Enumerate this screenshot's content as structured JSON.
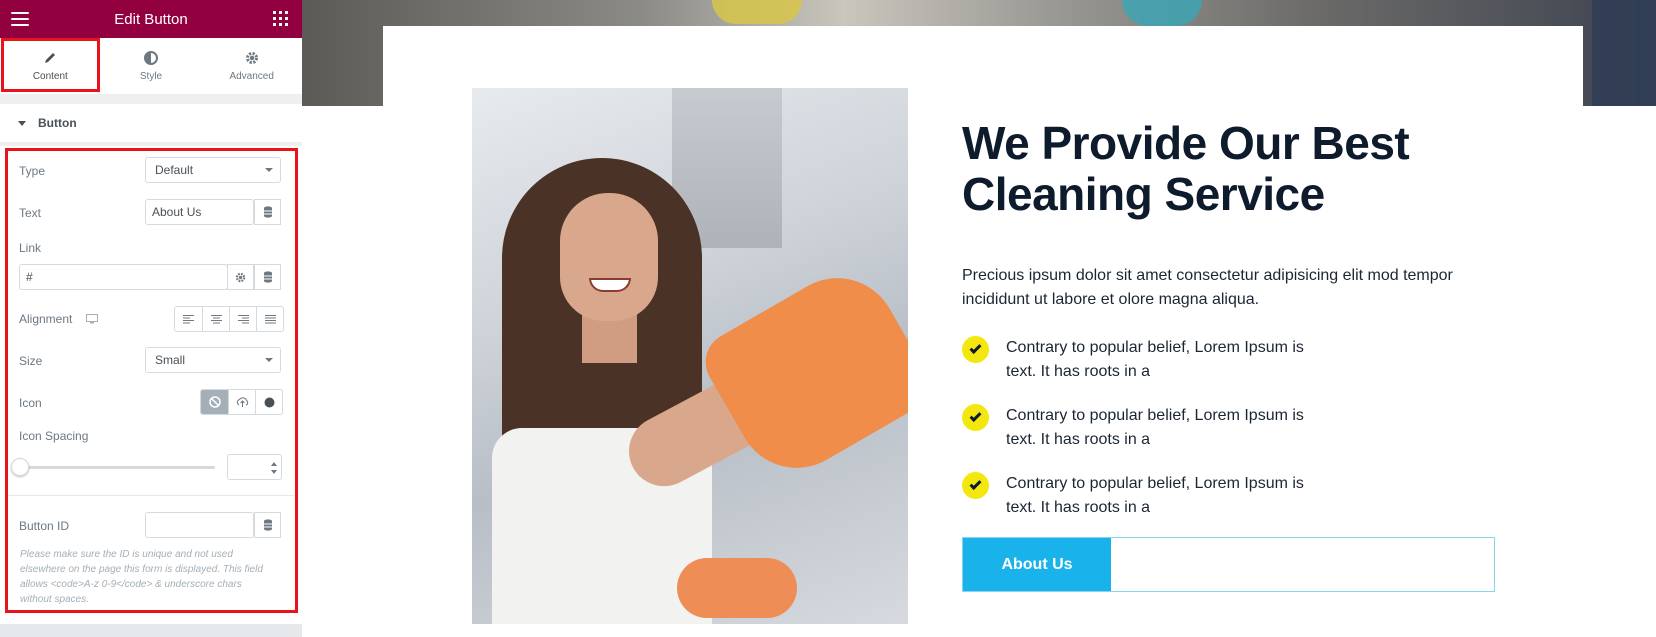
{
  "panel": {
    "title": "Edit Button",
    "tabs": [
      {
        "label": "Content",
        "icon": "pencil-icon",
        "active": true
      },
      {
        "label": "Style",
        "icon": "half-circle-icon",
        "active": false
      },
      {
        "label": "Advanced",
        "icon": "gear-icon",
        "active": false
      }
    ],
    "section_title": "Button",
    "controls": {
      "type_label": "Type",
      "type_value": "Default",
      "text_label": "Text",
      "text_value": "About Us",
      "link_label": "Link",
      "link_value": "#",
      "alignment_label": "Alignment",
      "size_label": "Size",
      "size_value": "Small",
      "icon_label": "Icon",
      "icon_spacing_label": "Icon Spacing",
      "button_id_label": "Button ID",
      "button_id_value": "",
      "help_text": "Please make sure the ID is unique and not used elsewhere on the page this form is displayed. This field allows <code>A-z 0-9</code> & underscore chars without spaces."
    },
    "highlight_color": "#e8141b",
    "header_color": "#93003f"
  },
  "canvas": {
    "heading": "We Provide Our Best Cleaning Service",
    "paragraph": "Precious ipsum dolor sit amet consectetur adipisicing elit mod tempor incididunt ut labore et olore magna aliqua.",
    "features": [
      "Contrary to popular belief, Lorem Ipsum is text. It has roots in a",
      "Contrary to popular belief, Lorem Ipsum is text. It has roots in a",
      "Contrary to popular belief, Lorem Ipsum is text. It has roots in a"
    ],
    "cta_label": "About Us",
    "accent_color": "#19b2eb",
    "check_color": "#f3e70f"
  }
}
